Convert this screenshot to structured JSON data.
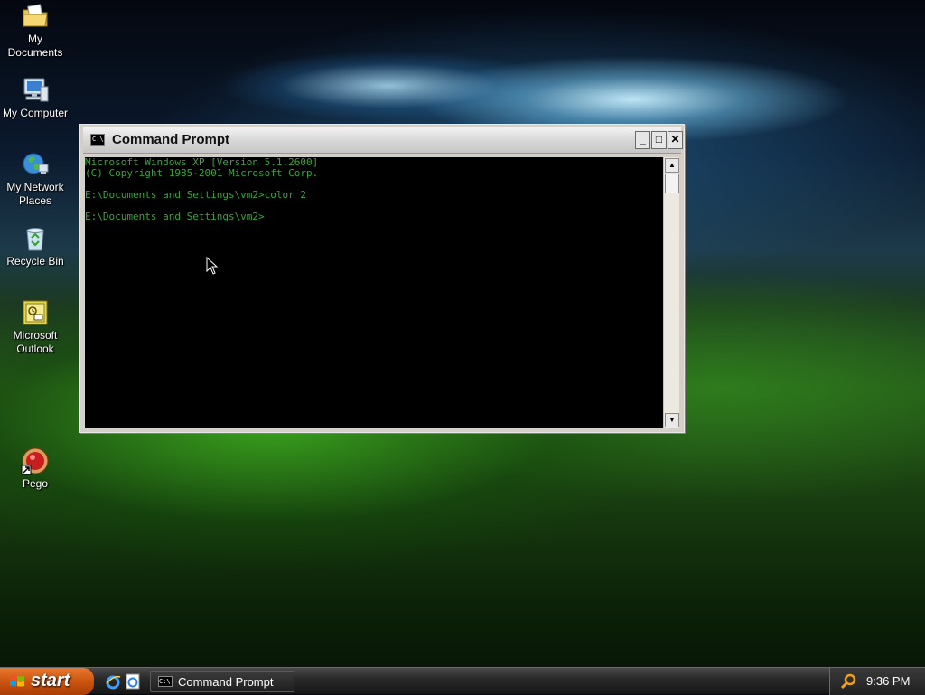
{
  "desktop": {
    "icons": [
      {
        "label": "My Documents"
      },
      {
        "label": "My Computer"
      },
      {
        "label": "My Network Places"
      },
      {
        "label": "Recycle Bin"
      },
      {
        "label": "Microsoft Outlook"
      },
      {
        "label": "Pego"
      }
    ]
  },
  "window": {
    "title": "Command Prompt",
    "icon_text": "C:\\",
    "minimize_label": "_",
    "maximize_label": "□",
    "close_label": "✕",
    "console_lines": [
      "Microsoft Windows XP [Version 5.1.2600]",
      "(C) Copyright 1985-2001 Microsoft Corp.",
      "",
      "E:\\Documents and Settings\\vm2>color 2",
      "",
      "E:\\Documents and Settings\\vm2>"
    ],
    "console_text_color": "#3aa53a",
    "scroll_up": "▲",
    "scroll_down": "▼"
  },
  "taskbar": {
    "start_label": "start",
    "task_label": "Command Prompt",
    "task_icon_text": "C:\\",
    "clock": "9:36 PM"
  }
}
